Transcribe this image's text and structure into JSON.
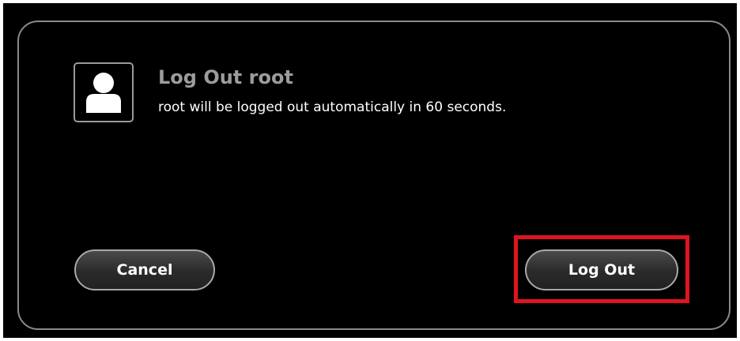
{
  "dialog": {
    "title": "Log Out root",
    "message": "root will be logged out automatically in 60 seconds.",
    "avatar_icon": "user-icon",
    "cancel_label": "Cancel",
    "logout_label": "Log Out",
    "highlight_color": "#e0141e"
  }
}
